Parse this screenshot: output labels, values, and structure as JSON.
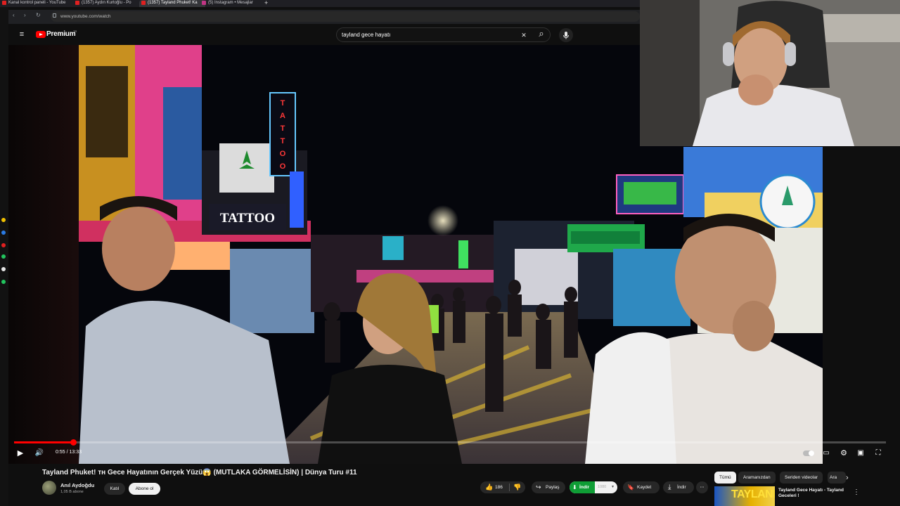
{
  "browser": {
    "tabs": [
      {
        "label": "Kanal kontrol paneli - YouTube"
      },
      {
        "label": "(1357) Aydın Kurtoğlu - Po"
      },
      {
        "label": "(1357) Tayland Phuket! Ka"
      },
      {
        "label": "(5) Instagram • Mesajlar"
      }
    ],
    "new_tab_glyph": "+",
    "url": "www.youtube.com/watch",
    "back_glyph": "‹",
    "forward_glyph": "›",
    "reload_glyph": "↻"
  },
  "header": {
    "menu_glyph": "≡",
    "brand": "Premium",
    "brand_sup": "TR",
    "search_value": "tayland gece hayatı",
    "clear_glyph": "✕",
    "search_glyph": "⌕",
    "mic_glyph": "🎙"
  },
  "extensions": {
    "icons": [
      "copy-icon",
      "sparkle-icon",
      "camera-icon"
    ],
    "glyphs": [
      "⧉",
      "✦",
      "■"
    ]
  },
  "video": {
    "signs": {
      "tattoo_vertical": "TATTOO",
      "tattoo_lower": "TATTOO"
    }
  },
  "player": {
    "time": "0:55 / 13:33",
    "progress": 0.068,
    "play_glyph": "▶",
    "volume_glyph": "🔊",
    "autoplay_glyph": "⏽",
    "subtitles_glyph": "▭",
    "settings_glyph": "⚙",
    "miniplayer_glyph": "▣",
    "fullscreen_glyph": "⛶"
  },
  "meta": {
    "title": "Tayland Phuket! ᴛʜ Gece Hayatının Gerçek Yüzü😱 (MUTLAKA GÖRMELİSİN) | Dünya Turu #11",
    "channel": "Anıl Aydoğdu",
    "subscribers": "1,05 B abone",
    "join_label": "Katıl",
    "subscribe_label": "Abone ol",
    "likes": "186",
    "like_glyph": "👍",
    "dislike_glyph": "👎",
    "share_label": "Paylaş",
    "share_glyph": "↪",
    "download_ext_label": "İndir",
    "quality_label": "1080",
    "save_label": "Kaydet",
    "save_glyph": "🔖",
    "download_label": "İndir",
    "download_glyph": "⤓",
    "more_glyph": "⋯"
  },
  "sidebar": {
    "chips": [
      "Tümü",
      "Aramanızdan",
      "Seriden videolar",
      "Ara"
    ],
    "next_glyph": "›",
    "rec_thumb_text": "TAYLAND",
    "rec_title": "Tayland Gece Hayatı - Tayland Geceleri !",
    "rec_more_glyph": "⋮"
  },
  "colors": {
    "accent": "#ff0000",
    "download_green": "#0f9d35",
    "background": "#0f0f0f"
  }
}
